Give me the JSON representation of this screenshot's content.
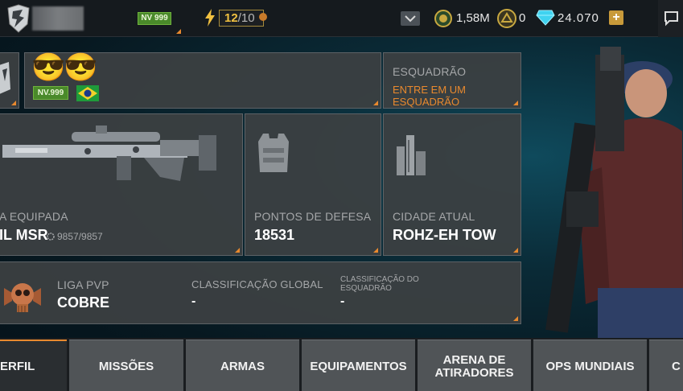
{
  "header": {
    "level_badge": "NV 999",
    "energy_current": "12",
    "energy_max": "/10",
    "cash": "1,58M",
    "tokens": "0",
    "diamonds": "24.070",
    "plus_label": "+"
  },
  "profile": {
    "level": "NV.999",
    "emoji_1": "😎",
    "emoji_2": "😎"
  },
  "squad": {
    "title": "ESQUADRÃO",
    "action": "ENTRE EM UM ESQUADRÃO"
  },
  "weapon": {
    "label": "A EQUIPADA",
    "name": "IL MSR",
    "durability": "9857/9857"
  },
  "defense": {
    "label": "PONTOS DE DEFESA",
    "value": "18531"
  },
  "city": {
    "label": "CIDADE ATUAL",
    "value": "ROHZ-EH TOW"
  },
  "pvp": {
    "league_label": "LIGA PVP",
    "league_value": "COBRE",
    "global_label": "CLASSIFICAÇÃO GLOBAL",
    "global_value": "-",
    "squad_label_1": "CLASSIFICAÇÃO DO",
    "squad_label_2": "ESQUADRÃO",
    "squad_value": "-"
  },
  "tabs": [
    {
      "label": "ERFIL"
    },
    {
      "label": "MISSÕES"
    },
    {
      "label": "ARMAS"
    },
    {
      "label": "EQUIPAMENTOS"
    },
    {
      "label_1": "ARENA DE",
      "label_2": "ATIRADORES"
    },
    {
      "label": "OPS MUNDIAIS"
    },
    {
      "label": "C"
    }
  ],
  "colors": {
    "accent": "#e8892e",
    "level_green": "#4a8a2a",
    "energy_gold": "#f0c040",
    "diamond": "#3fd3f0"
  }
}
